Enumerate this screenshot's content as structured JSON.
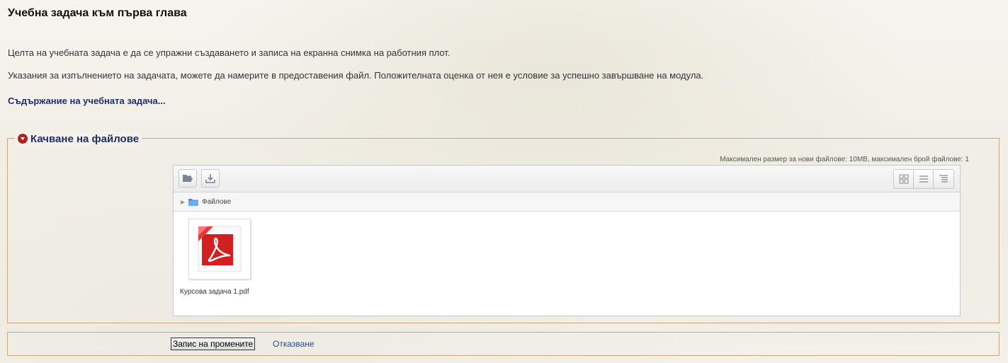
{
  "page": {
    "title": "Учебна задача към първа глава",
    "description_1": "Целта на учебната задача е да се упражни създаването и записа на екранна снимка на работния плот.",
    "description_2": "Указания за изпълнението на задачата, можете да намерите в предоставения файл. Положителната оценка от нея е условие за успешно завършване на модула.",
    "content_link": "Съдържание на учебната задача..."
  },
  "upload": {
    "legend": "Качване на файлове",
    "max_info": "Максимален размер за нови файлове: 10MB, максимален брой файлове: 1",
    "toolbar": {
      "create_folder_icon": "folder-add-icon",
      "download_icon": "download-icon",
      "view_modes": [
        "grid-view-icon",
        "list-view-icon",
        "tree-view-icon"
      ]
    },
    "path": {
      "folder_label": "Файлове"
    },
    "files": [
      {
        "name": "Курсова задача 1.pdf",
        "icon": "pdf-file-icon"
      }
    ]
  },
  "actions": {
    "save_label": "Запис на промените",
    "cancel_label": "Отказване"
  },
  "colors": {
    "accent_link": "#1f2e63",
    "legend_icon": "#b32020",
    "border": "#c9a978",
    "pdf_red": "#d21f1f"
  }
}
